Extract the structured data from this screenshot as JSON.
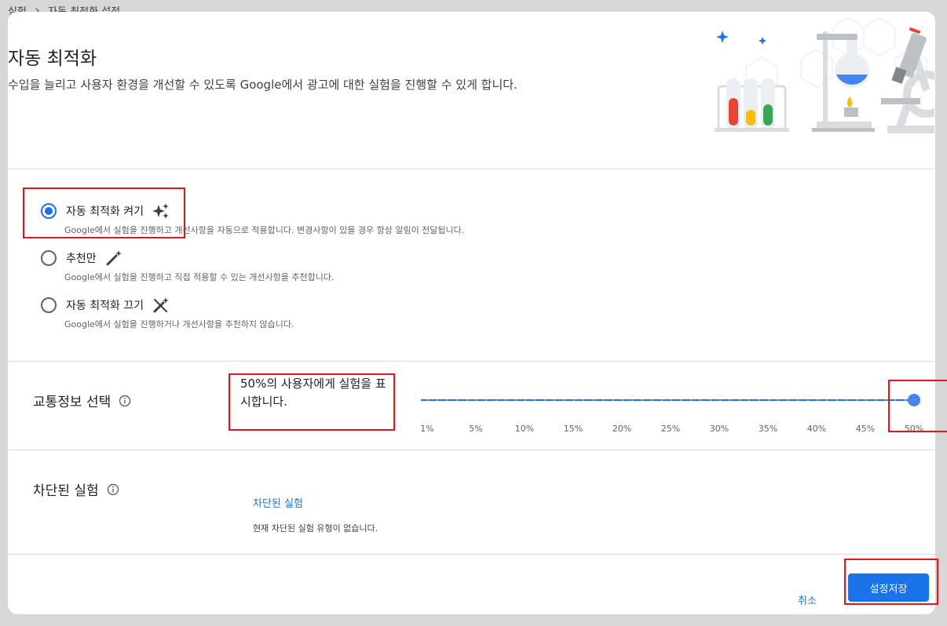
{
  "breadcrumb": {
    "parent": "실험",
    "current": "자동 최적화 설정"
  },
  "header": {
    "title": "자동 최적화",
    "subtitle": "수입을 늘리고 사용자 환경을 개선할 수 있도록 Google에서 광고에 대한 실험을 진행할 수 있게 합니다."
  },
  "options": [
    {
      "label": "자동 최적화 켜기",
      "desc": "Google에서 실험을 진행하고 개선사항을 자동으로 적용합니다. 변경사항이 있을 경우 항상 알림이 전달됩니다.",
      "icon": "sparkle-icon",
      "selected": true
    },
    {
      "label": "추천만",
      "desc": "Google에서 실험을 진행하고 직접 적용할 수 있는 개선사항을 추천합니다.",
      "icon": "magic-wand-icon",
      "selected": false
    },
    {
      "label": "자동 최적화 끄기",
      "desc": "Google에서 실험을 진행하거나 개선사항을 추천하지 않습니다.",
      "icon": "magic-wand-off-icon",
      "selected": false
    }
  ],
  "traffic": {
    "label": "교통정보 선택",
    "description": "50%의 사용자에게 실험을 표시합니다.",
    "value_percent": 50,
    "ticks": [
      "1%",
      "5%",
      "10%",
      "15%",
      "20%",
      "25%",
      "30%",
      "35%",
      "40%",
      "45%",
      "50%"
    ]
  },
  "blocked": {
    "label": "차단된 실험",
    "link": "차단된 실험",
    "note": "현재 차단된 실험 유형이 없습니다."
  },
  "footer": {
    "cancel": "취소",
    "save": "설정저장"
  },
  "colors": {
    "accent": "#1a73e8",
    "highlight": "#e3141a"
  }
}
